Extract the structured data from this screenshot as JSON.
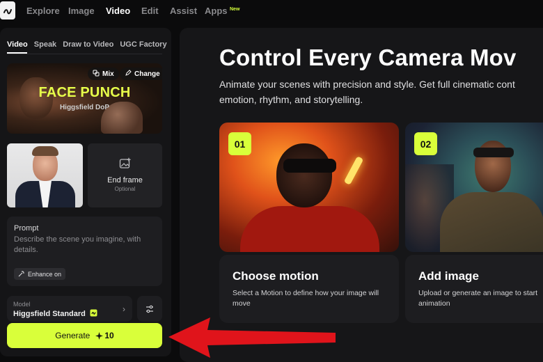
{
  "nav": {
    "items": [
      {
        "label": "Explore",
        "active": false
      },
      {
        "label": "Image",
        "active": false
      },
      {
        "label": "Video",
        "active": true
      },
      {
        "label": "Edit",
        "active": false
      },
      {
        "label": "Assist",
        "active": false
      },
      {
        "label": "Apps",
        "active": false
      }
    ],
    "new_badge": "New"
  },
  "sidebar": {
    "tabs": [
      {
        "label": "Video",
        "active": true
      },
      {
        "label": "Speak",
        "active": false
      },
      {
        "label": "Draw to Video",
        "active": false
      },
      {
        "label": "UGC Factory",
        "active": false
      }
    ],
    "preset": {
      "title": "FACE PUNCH",
      "subtitle": "Higgsfield DoP",
      "mix_label": "Mix",
      "change_label": "Change"
    },
    "end_frame": {
      "label": "End frame",
      "sub": "Optional"
    },
    "prompt": {
      "label": "Prompt",
      "placeholder": "Describe the scene you imagine, with details.",
      "enhance_label": "Enhance on"
    },
    "model": {
      "label": "Model",
      "value": "Higgsfield Standard"
    },
    "generate": {
      "label": "Generate",
      "cost": "10"
    }
  },
  "main": {
    "title": "Control Every Camera Mov",
    "description": "Animate your scenes with precision and style. Get full cinematic cont emotion, rhythm, and storytelling.",
    "cards": [
      {
        "number": "01",
        "title": "Choose motion",
        "desc": "Select a Motion to define how your image will move"
      },
      {
        "number": "02",
        "title": "Add image",
        "desc": "Upload or generate an image to start animation"
      }
    ]
  },
  "colors": {
    "accent": "#d9ff3a",
    "arrow": "#e0141b",
    "background": "#0b0b0c",
    "panel": "#151517"
  },
  "icons": [
    "logo-icon",
    "mix-icon",
    "pencil-icon",
    "image-add-icon",
    "sparkle-icon",
    "chevron-right-icon",
    "sliders-icon"
  ]
}
